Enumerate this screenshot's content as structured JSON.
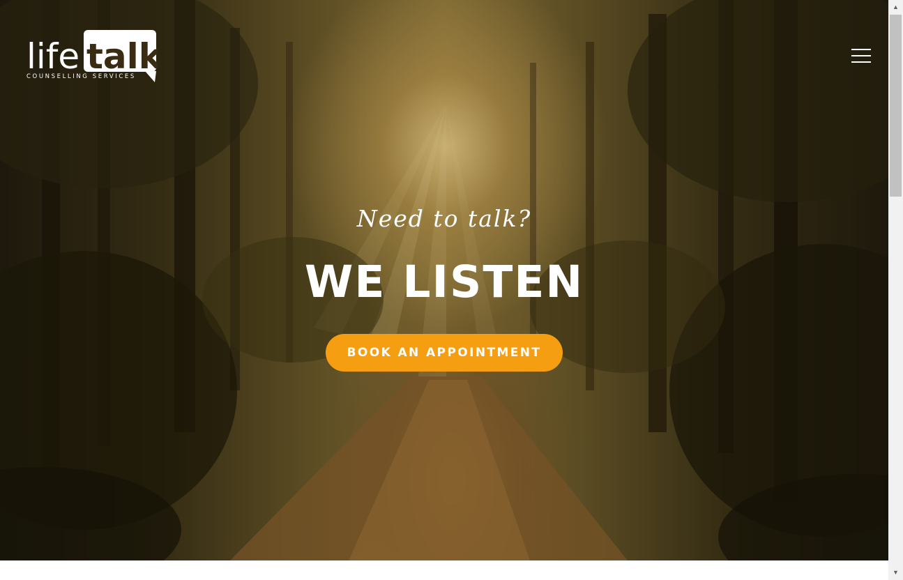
{
  "header": {
    "logo": {
      "wordmark_light": "life",
      "wordmark_bold": "talk",
      "subtitle": "COUNSELLING SERVICES"
    },
    "menu_icon": "hamburger-menu-icon"
  },
  "hero": {
    "tagline": "Need to talk?",
    "headline": "WE LISTEN",
    "cta_label": "BOOK AN APPOINTMENT"
  },
  "scrollbar": {
    "up_icon": "▲",
    "down_icon": "▼"
  },
  "colors": {
    "accent": "#f59e12",
    "text_on_hero": "#ffffff"
  }
}
